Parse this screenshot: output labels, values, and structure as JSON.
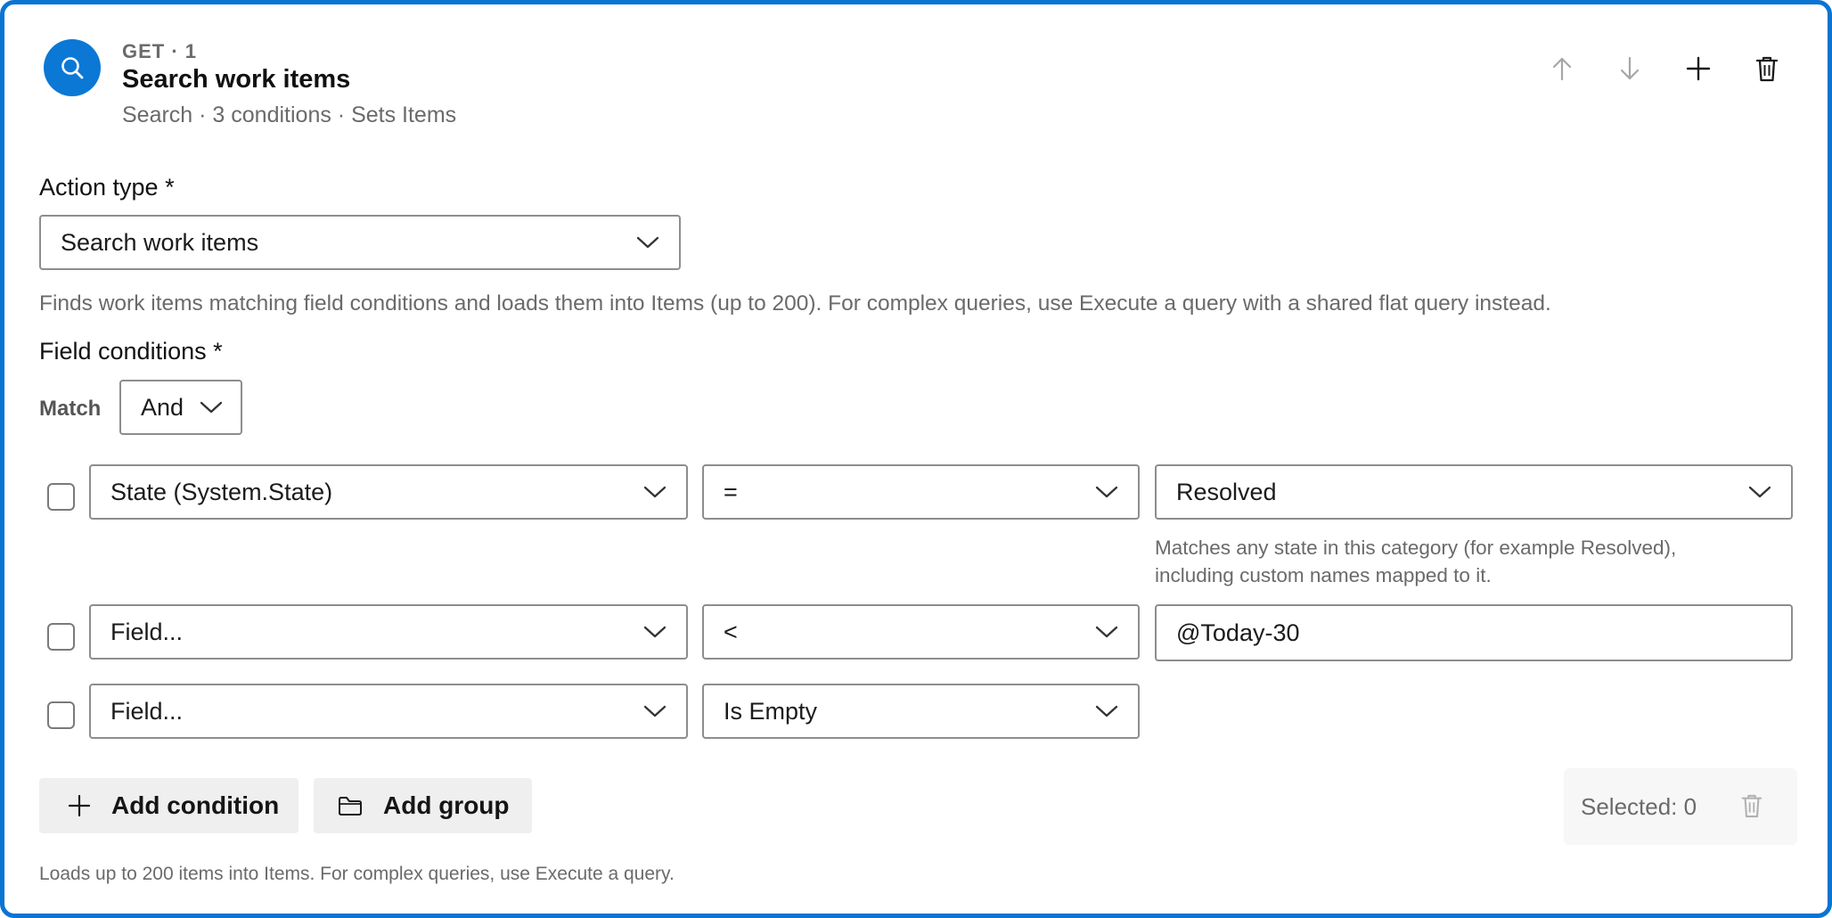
{
  "header": {
    "eyebrow": "GET · 1",
    "title": "Search work items",
    "subtitle": "Search · 3 conditions · Sets Items",
    "avatar_icon": "search-icon",
    "tools": [
      "arrow-up-icon",
      "arrow-down-icon",
      "plus-icon",
      "trash-icon"
    ]
  },
  "action_type": {
    "label": "Action type *",
    "value": "Search work items",
    "description": "Finds work items matching field conditions and loads them into Items (up to 200). For complex queries, use Execute a query with a shared flat query instead."
  },
  "conditions": {
    "label": "Field conditions *",
    "match_label": "Match",
    "match_value": "And",
    "rows": [
      {
        "field": "State (System.State)",
        "operator": "=",
        "value": "Resolved",
        "hint_line1": "Matches any state in this category (for example Resolved),",
        "hint_line2": "including custom names mapped to it."
      },
      {
        "field": "Field...",
        "operator": "<",
        "value": "@Today-30"
      },
      {
        "field": "Field...",
        "operator": "Is Empty"
      }
    ]
  },
  "footer": {
    "add_condition": "Add condition",
    "add_group": "Add group",
    "selected": "Selected: 0",
    "note": "Loads up to 200 items into Items. For complex queries, use Execute a query."
  },
  "colors": {
    "accent": "#0a74d3",
    "avatar": "#0b78d6",
    "muted_text": "#6a6a6a",
    "button_bg": "#efefef"
  }
}
